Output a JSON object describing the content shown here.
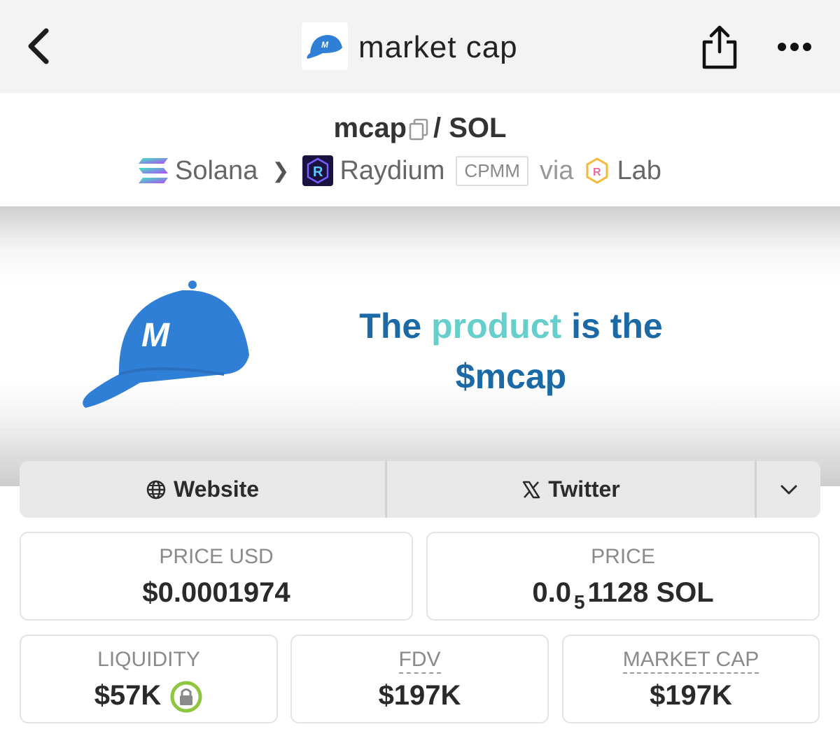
{
  "topbar": {
    "title": "market cap",
    "logo_icon": "blue-cap-m-logo",
    "back_icon": "chevron-left-icon",
    "share_icon": "share-icon",
    "more_icon": "ellipsis-icon"
  },
  "pair": {
    "base": "mcap",
    "slash": "/",
    "quote": "SOL",
    "chain": "Solana",
    "dex": "Raydium",
    "pool_type": "CPMM",
    "via_word": "via",
    "launchpad": "Lab"
  },
  "banner": {
    "line1_part1": "The",
    "line1_accent": "product",
    "line1_part2": "is the",
    "line2": "$mcap",
    "cap_letter": "M",
    "text_color": "#1b6aa6",
    "accent_color": "#66cfcb",
    "cap_color": "#2f7fd6"
  },
  "links": {
    "website": "Website",
    "twitter": "Twitter"
  },
  "stats": {
    "price_usd_label": "PRICE USD",
    "price_usd_value": "$0.0001974",
    "price_label": "PRICE",
    "price_value_prefix": "0.0",
    "price_value_sub": "5",
    "price_value_suffix": "1128 SOL",
    "liquidity_label": "LIQUIDITY",
    "liquidity_value": "$57K",
    "fdv_label": "FDV",
    "fdv_value": "$197K",
    "mcap_label": "MARKET CAP",
    "mcap_value": "$197K"
  }
}
